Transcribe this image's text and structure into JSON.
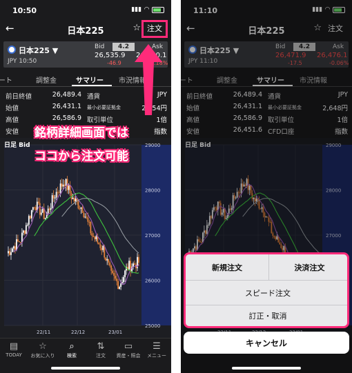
{
  "left": {
    "status_time": "10:50",
    "nav_title": "日本225",
    "order_label": "注文",
    "quote": {
      "symbol": "日本225 ▼",
      "currency_time": "JPY 10:50",
      "bid_label": "Bid",
      "ask_label": "Ask",
      "spread": "4.2",
      "bid": "26,535.9",
      "ask": "26,540.1",
      "bid_change": "-46.9",
      "ask_change": "-0.18%"
    },
    "tabs": [
      "チャート",
      "調整金",
      "サマリー",
      "市況情報"
    ],
    "stats": [
      {
        "k1": "前日終値",
        "v1": "26,489.4",
        "k2": "通貨",
        "v2": "JPY"
      },
      {
        "k1": "始値",
        "v1": "26,431.1",
        "k2": "最小必要証拠金",
        "v2": "2,654円"
      },
      {
        "k1": "高値",
        "v1": "26,586.9",
        "k2": "取引単位",
        "v2": "1倍"
      },
      {
        "k1": "安値",
        "v1": "26,451.6",
        "k2": "",
        "v2": "指数"
      }
    ],
    "chart_label": "日足 Bid",
    "overlay_line1": "銘柄詳細画面では",
    "overlay_line2": "ココから注文可能",
    "bottom_nav": [
      "TODAY",
      "お気に入り",
      "検索",
      "注文",
      "資産・照会",
      "メニュー"
    ]
  },
  "right": {
    "status_time": "11:10",
    "nav_title": "日本225",
    "order_label": "注文",
    "quote": {
      "symbol": "日本225 ▼",
      "currency_time": "JPY 11:10",
      "bid_label": "Bid",
      "ask_label": "Ask",
      "spread": "4.2",
      "bid": "26,471.9",
      "ask": "26,476.1",
      "bid_change": "-17.5",
      "ask_change": "-0.06%"
    },
    "tabs": [
      "チャート",
      "調整金",
      "サマリー",
      "市況情報"
    ],
    "stats": [
      {
        "k1": "前日終値",
        "v1": "26,489.4",
        "k2": "通貨",
        "v2": "JPY"
      },
      {
        "k1": "始値",
        "v1": "26,431.1",
        "k2": "最小必要証拠金",
        "v2": "2,648円"
      },
      {
        "k1": "高値",
        "v1": "26,586.9",
        "k2": "取引単位",
        "v2": "1倍"
      },
      {
        "k1": "安値",
        "v1": "26,451.6",
        "k2": "CFD口座",
        "v2": "指数"
      }
    ],
    "chart_label": "日足 Bid",
    "sheet": {
      "new_order": "新規注文",
      "settle_order": "決済注文",
      "speed_order": "スピード注文",
      "modify_cancel": "訂正・取消"
    },
    "cancel_label": "キャンセル"
  },
  "chart_data": {
    "type": "candlestick",
    "title": "日足 Bid",
    "x_ticks": [
      "22/11",
      "22/12",
      "23/01"
    ],
    "y_ticks": [
      29000,
      28000,
      27000,
      26000,
      25000
    ],
    "ylim": [
      25000,
      29000
    ],
    "colors": {
      "up": "#ffffff",
      "down": "#e8833a",
      "ma_short": "#9b59b6",
      "ma_long": "#3ec43e",
      "ma_mid": "#9aa0a6",
      "band": "#1c2a66"
    }
  }
}
